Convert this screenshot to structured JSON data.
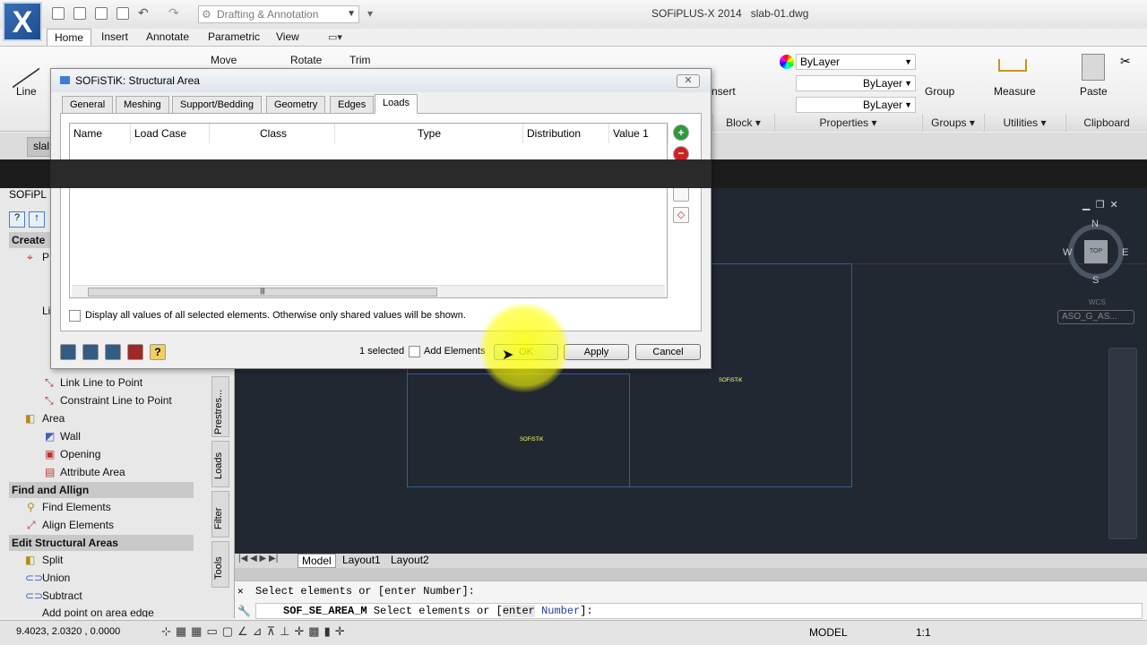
{
  "app": {
    "title": "SOFiPLUS-X 2014",
    "filename": "slab-01.dwg",
    "workspace": "Drafting & Annotation",
    "logo": "X"
  },
  "ribbon_tabs": [
    "Home",
    "Insert",
    "Annotate",
    "Parametric",
    "View"
  ],
  "ribbon": {
    "draw": {
      "line": "Line"
    },
    "modify": {
      "move": "Move",
      "rotate": "Rotate",
      "trim": "Trim"
    },
    "block": {
      "insert": "nsert",
      "label": "Block"
    },
    "properties": {
      "label": "Properties",
      "color": "ByLayer",
      "linetype": "ByLayer",
      "lineweight": "ByLayer"
    },
    "groups": {
      "group": "Group",
      "label": "Groups"
    },
    "utilities": {
      "measure": "Measure",
      "label": "Utilities"
    },
    "clipboard": {
      "paste": "Paste",
      "label": "Clipboard"
    }
  },
  "doc_tab": "slal",
  "dialog": {
    "title": "SOFiSTiK: Structural Area",
    "tabs": [
      "General",
      "Meshing",
      "Support/Bedding",
      "Geometry",
      "Edges",
      "Loads"
    ],
    "active_tab": "Loads",
    "columns": [
      "Name",
      "Load Case",
      "Class",
      "Type",
      "Distribution",
      "Value 1"
    ],
    "display_all_label": "Display all values of all selected elements. Otherwise only shared values will be shown.",
    "selected_count": "1 selected",
    "add_elements_label": "Add Elements",
    "ok": "OK",
    "apply": "Apply",
    "cancel": "Cancel",
    "close": "✕",
    "scroll_grip": "|||"
  },
  "palette": {
    "title": "SOFiPL",
    "create_header": "Create",
    "items_partial": [
      "P",
      "Li"
    ],
    "items": [
      {
        "label": "Link Line to Point"
      },
      {
        "label": "Constraint Line to Point"
      },
      {
        "label": "Area"
      },
      {
        "label": "Wall"
      },
      {
        "label": "Opening"
      },
      {
        "label": "Attribute Area"
      }
    ],
    "find_header": "Find and Allign",
    "find_items": [
      "Find Elements",
      "Align Elements"
    ],
    "edit_header": "Edit Structural Areas",
    "edit_items": [
      "Split",
      "Union",
      "Subtract",
      "Add point on area edge"
    ],
    "side_tabs": [
      "Prestres...",
      "Loads",
      "Filter",
      "Tools"
    ]
  },
  "viewcube": {
    "n": "N",
    "s": "S",
    "e": "E",
    "w": "W",
    "top": "TOP",
    "wcs": "WCS",
    "ucs": "ASO_G_AS..."
  },
  "layout_tabs": [
    "Model",
    "Layout1",
    "Layout2"
  ],
  "command": {
    "history": "Select elements or [enter Number]:",
    "current_cmd": "SOF_SE_AREA_M",
    "current_prompt": "Select elements or [",
    "kw1": "enter",
    "kw2": "Number",
    "prompt_end": "]:"
  },
  "status": {
    "coords": "9.4023, 2.0320 , 0.0000",
    "model": "MODEL",
    "scale": "1:1"
  },
  "canvas_labels": {
    "a": "SOFiSTiK",
    "b": "SOFiSTiK"
  },
  "colors": {
    "canvas": "#212832",
    "accent": "#3a6fb5",
    "area_outline": "#2f5f9a"
  }
}
